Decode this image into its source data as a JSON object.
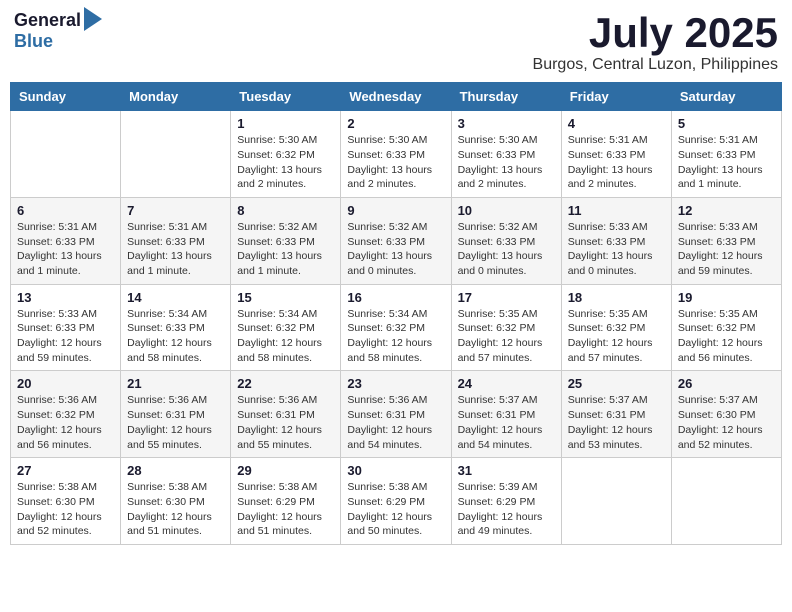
{
  "logo": {
    "general": "General",
    "blue": "Blue"
  },
  "title": "July 2025",
  "subtitle": "Burgos, Central Luzon, Philippines",
  "days_of_week": [
    "Sunday",
    "Monday",
    "Tuesday",
    "Wednesday",
    "Thursday",
    "Friday",
    "Saturday"
  ],
  "weeks": [
    [
      {
        "day": "",
        "info": ""
      },
      {
        "day": "",
        "info": ""
      },
      {
        "day": "1",
        "info": "Sunrise: 5:30 AM\nSunset: 6:32 PM\nDaylight: 13 hours and 2 minutes."
      },
      {
        "day": "2",
        "info": "Sunrise: 5:30 AM\nSunset: 6:33 PM\nDaylight: 13 hours and 2 minutes."
      },
      {
        "day": "3",
        "info": "Sunrise: 5:30 AM\nSunset: 6:33 PM\nDaylight: 13 hours and 2 minutes."
      },
      {
        "day": "4",
        "info": "Sunrise: 5:31 AM\nSunset: 6:33 PM\nDaylight: 13 hours and 2 minutes."
      },
      {
        "day": "5",
        "info": "Sunrise: 5:31 AM\nSunset: 6:33 PM\nDaylight: 13 hours and 1 minute."
      }
    ],
    [
      {
        "day": "6",
        "info": "Sunrise: 5:31 AM\nSunset: 6:33 PM\nDaylight: 13 hours and 1 minute."
      },
      {
        "day": "7",
        "info": "Sunrise: 5:31 AM\nSunset: 6:33 PM\nDaylight: 13 hours and 1 minute."
      },
      {
        "day": "8",
        "info": "Sunrise: 5:32 AM\nSunset: 6:33 PM\nDaylight: 13 hours and 1 minute."
      },
      {
        "day": "9",
        "info": "Sunrise: 5:32 AM\nSunset: 6:33 PM\nDaylight: 13 hours and 0 minutes."
      },
      {
        "day": "10",
        "info": "Sunrise: 5:32 AM\nSunset: 6:33 PM\nDaylight: 13 hours and 0 minutes."
      },
      {
        "day": "11",
        "info": "Sunrise: 5:33 AM\nSunset: 6:33 PM\nDaylight: 13 hours and 0 minutes."
      },
      {
        "day": "12",
        "info": "Sunrise: 5:33 AM\nSunset: 6:33 PM\nDaylight: 12 hours and 59 minutes."
      }
    ],
    [
      {
        "day": "13",
        "info": "Sunrise: 5:33 AM\nSunset: 6:33 PM\nDaylight: 12 hours and 59 minutes."
      },
      {
        "day": "14",
        "info": "Sunrise: 5:34 AM\nSunset: 6:33 PM\nDaylight: 12 hours and 58 minutes."
      },
      {
        "day": "15",
        "info": "Sunrise: 5:34 AM\nSunset: 6:32 PM\nDaylight: 12 hours and 58 minutes."
      },
      {
        "day": "16",
        "info": "Sunrise: 5:34 AM\nSunset: 6:32 PM\nDaylight: 12 hours and 58 minutes."
      },
      {
        "day": "17",
        "info": "Sunrise: 5:35 AM\nSunset: 6:32 PM\nDaylight: 12 hours and 57 minutes."
      },
      {
        "day": "18",
        "info": "Sunrise: 5:35 AM\nSunset: 6:32 PM\nDaylight: 12 hours and 57 minutes."
      },
      {
        "day": "19",
        "info": "Sunrise: 5:35 AM\nSunset: 6:32 PM\nDaylight: 12 hours and 56 minutes."
      }
    ],
    [
      {
        "day": "20",
        "info": "Sunrise: 5:36 AM\nSunset: 6:32 PM\nDaylight: 12 hours and 56 minutes."
      },
      {
        "day": "21",
        "info": "Sunrise: 5:36 AM\nSunset: 6:31 PM\nDaylight: 12 hours and 55 minutes."
      },
      {
        "day": "22",
        "info": "Sunrise: 5:36 AM\nSunset: 6:31 PM\nDaylight: 12 hours and 55 minutes."
      },
      {
        "day": "23",
        "info": "Sunrise: 5:36 AM\nSunset: 6:31 PM\nDaylight: 12 hours and 54 minutes."
      },
      {
        "day": "24",
        "info": "Sunrise: 5:37 AM\nSunset: 6:31 PM\nDaylight: 12 hours and 54 minutes."
      },
      {
        "day": "25",
        "info": "Sunrise: 5:37 AM\nSunset: 6:31 PM\nDaylight: 12 hours and 53 minutes."
      },
      {
        "day": "26",
        "info": "Sunrise: 5:37 AM\nSunset: 6:30 PM\nDaylight: 12 hours and 52 minutes."
      }
    ],
    [
      {
        "day": "27",
        "info": "Sunrise: 5:38 AM\nSunset: 6:30 PM\nDaylight: 12 hours and 52 minutes."
      },
      {
        "day": "28",
        "info": "Sunrise: 5:38 AM\nSunset: 6:30 PM\nDaylight: 12 hours and 51 minutes."
      },
      {
        "day": "29",
        "info": "Sunrise: 5:38 AM\nSunset: 6:29 PM\nDaylight: 12 hours and 51 minutes."
      },
      {
        "day": "30",
        "info": "Sunrise: 5:38 AM\nSunset: 6:29 PM\nDaylight: 12 hours and 50 minutes."
      },
      {
        "day": "31",
        "info": "Sunrise: 5:39 AM\nSunset: 6:29 PM\nDaylight: 12 hours and 49 minutes."
      },
      {
        "day": "",
        "info": ""
      },
      {
        "day": "",
        "info": ""
      }
    ]
  ]
}
